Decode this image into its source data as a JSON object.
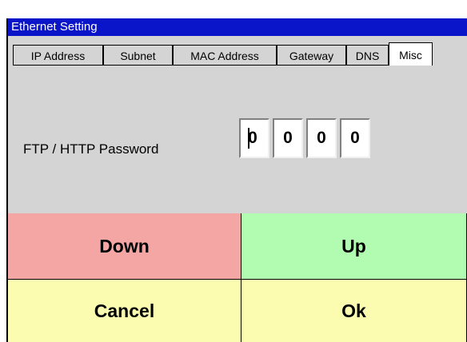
{
  "window": {
    "title": "Ethernet Setting"
  },
  "tabs": [
    {
      "label": "IP Address",
      "active": false
    },
    {
      "label": "Subnet",
      "active": false
    },
    {
      "label": "MAC Address",
      "active": false
    },
    {
      "label": "Gateway",
      "active": false
    },
    {
      "label": "DNS",
      "active": false
    },
    {
      "label": "Misc",
      "active": true
    }
  ],
  "misc": {
    "password_label": "FTP / HTTP Password",
    "digits": [
      "0",
      "0",
      "0",
      "0"
    ]
  },
  "buttons": {
    "down": "Down",
    "up": "Up",
    "cancel": "Cancel",
    "ok": "Ok"
  },
  "colors": {
    "titlebar": "#0a14c8",
    "down_bg": "#f4a6a4",
    "up_bg": "#b2fcb2",
    "cancel_bg": "#fcfcb0",
    "ok_bg": "#fcfcb0"
  }
}
